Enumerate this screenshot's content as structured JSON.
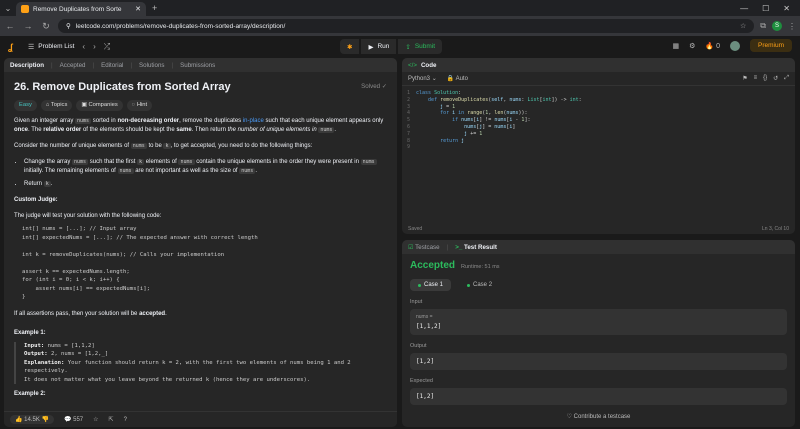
{
  "browser": {
    "tab_title": "Remove Duplicates from Sorte",
    "url": "leetcode.com/problems/remove-duplicates-from-sorted-array/description/",
    "profile_initial": "S"
  },
  "header": {
    "problem_list": "Problem List",
    "run": "Run",
    "submit": "Submit",
    "streak": "0",
    "premium": "Premium"
  },
  "left_tabs": [
    "Description",
    "Accepted",
    "Editorial",
    "Solutions",
    "Submissions"
  ],
  "problem": {
    "title": "26. Remove Duplicates from Sorted Array",
    "status": "Solved",
    "difficulty": "Easy",
    "tags": [
      "Topics",
      "Companies",
      "Hint"
    ],
    "intro_1": "Given an integer array ",
    "nums": "nums",
    "intro_2": " sorted in ",
    "nondecreasing": "non-decreasing order",
    "intro_3": ", remove the duplicates ",
    "inplace": "in-place",
    "intro_4": " such that each unique element appears only ",
    "once": "once",
    "intro_5": ". The ",
    "relative": "relative order",
    "intro_6": " of the elements should be kept the ",
    "same": "same",
    "intro_7": ". Then return ",
    "intro_8": "the number of unique elements in ",
    "p2_1": "Consider the number of unique elements of ",
    "p2_2": " to be ",
    "k": "k",
    "p2_3": ", to get accepted, you need to do the following things:",
    "bullet1_1": "Change the array ",
    "bullet1_2": " such that the first ",
    "bullet1_3": " elements of ",
    "bullet1_4": " contain the unique elements in the order they were present in ",
    "bullet1_5": " initially. The remaining elements of ",
    "bullet1_6": " are not important as well as the size of ",
    "bullet2": "Return ",
    "custom_judge": "Custom Judge:",
    "judge_text": "The judge will test your solution with the following code:",
    "judge_code": "int[] nums = [...]; // Input array\nint[] expectedNums = [...]; // The expected answer with correct length\n\nint k = removeDuplicates(nums); // Calls your implementation\n\nassert k == expectedNums.length;\nfor (int i = 0; i < k; i++) {\n    assert nums[i] == expectedNums[i];\n}",
    "assert_1": "If all assertions pass, then your solution will be ",
    "accepted_word": "accepted",
    "example1": "Example 1:",
    "ex1_input_label": "Input:",
    "ex1_input": " nums = [1,1,2]",
    "ex1_output_label": "Output:",
    "ex1_output": " 2, nums = [1,2,_]",
    "ex1_expl_label": "Explanation:",
    "ex1_expl": " Your function should return k = 2, with the first two elements of nums being 1 and 2 respectively.",
    "ex1_expl2": "It does not matter what you leave beyond the returned k (hence they are underscores).",
    "example2": "Example 2:"
  },
  "left_footer": {
    "likes": "14.5K",
    "comments": "557"
  },
  "code_panel": {
    "title": "Code",
    "language": "Python3",
    "auto": "Auto",
    "saved": "Saved",
    "cursor": "Ln 3, Col 10"
  },
  "result_panel": {
    "tab_testcase": "Testcase",
    "tab_result": "Test Result",
    "verdict": "Accepted",
    "runtime": "Runtime: 51 ms",
    "case1": "Case 1",
    "case2": "Case 2",
    "input_label": "Input",
    "input_var": "nums =",
    "input_value": "[1,1,2]",
    "output_label": "Output",
    "output_value": "[1,2]",
    "expected_label": "Expected",
    "expected_value": "[1,2]",
    "contribute": "Contribute a testcase"
  }
}
